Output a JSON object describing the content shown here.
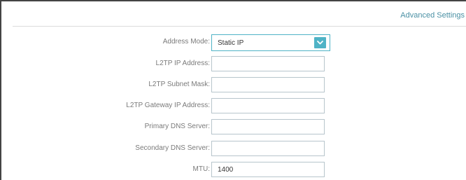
{
  "header": {
    "advanced_settings_link": "Advanced Settings"
  },
  "form": {
    "address_mode": {
      "label": "Address Mode:",
      "selected": "Static IP"
    },
    "l2tp_ip_address": {
      "label": "L2TP IP Address:",
      "value": ""
    },
    "l2tp_subnet_mask": {
      "label": "L2TP Subnet Mask:",
      "value": ""
    },
    "l2tp_gateway_ip": {
      "label": "L2TP Gateway IP Address:",
      "value": ""
    },
    "primary_dns": {
      "label": "Primary DNS Server:",
      "value": ""
    },
    "secondary_dns": {
      "label": "Secondary DNS Server:",
      "value": ""
    },
    "mtu": {
      "label": "MTU:",
      "value": "1400"
    }
  },
  "colors": {
    "accent": "#4fb3c6",
    "link": "#4a90a4",
    "label": "#7a7a7a",
    "input_border": "#b7c5cc"
  },
  "icons": {
    "dropdown": "chevron-down-icon"
  }
}
